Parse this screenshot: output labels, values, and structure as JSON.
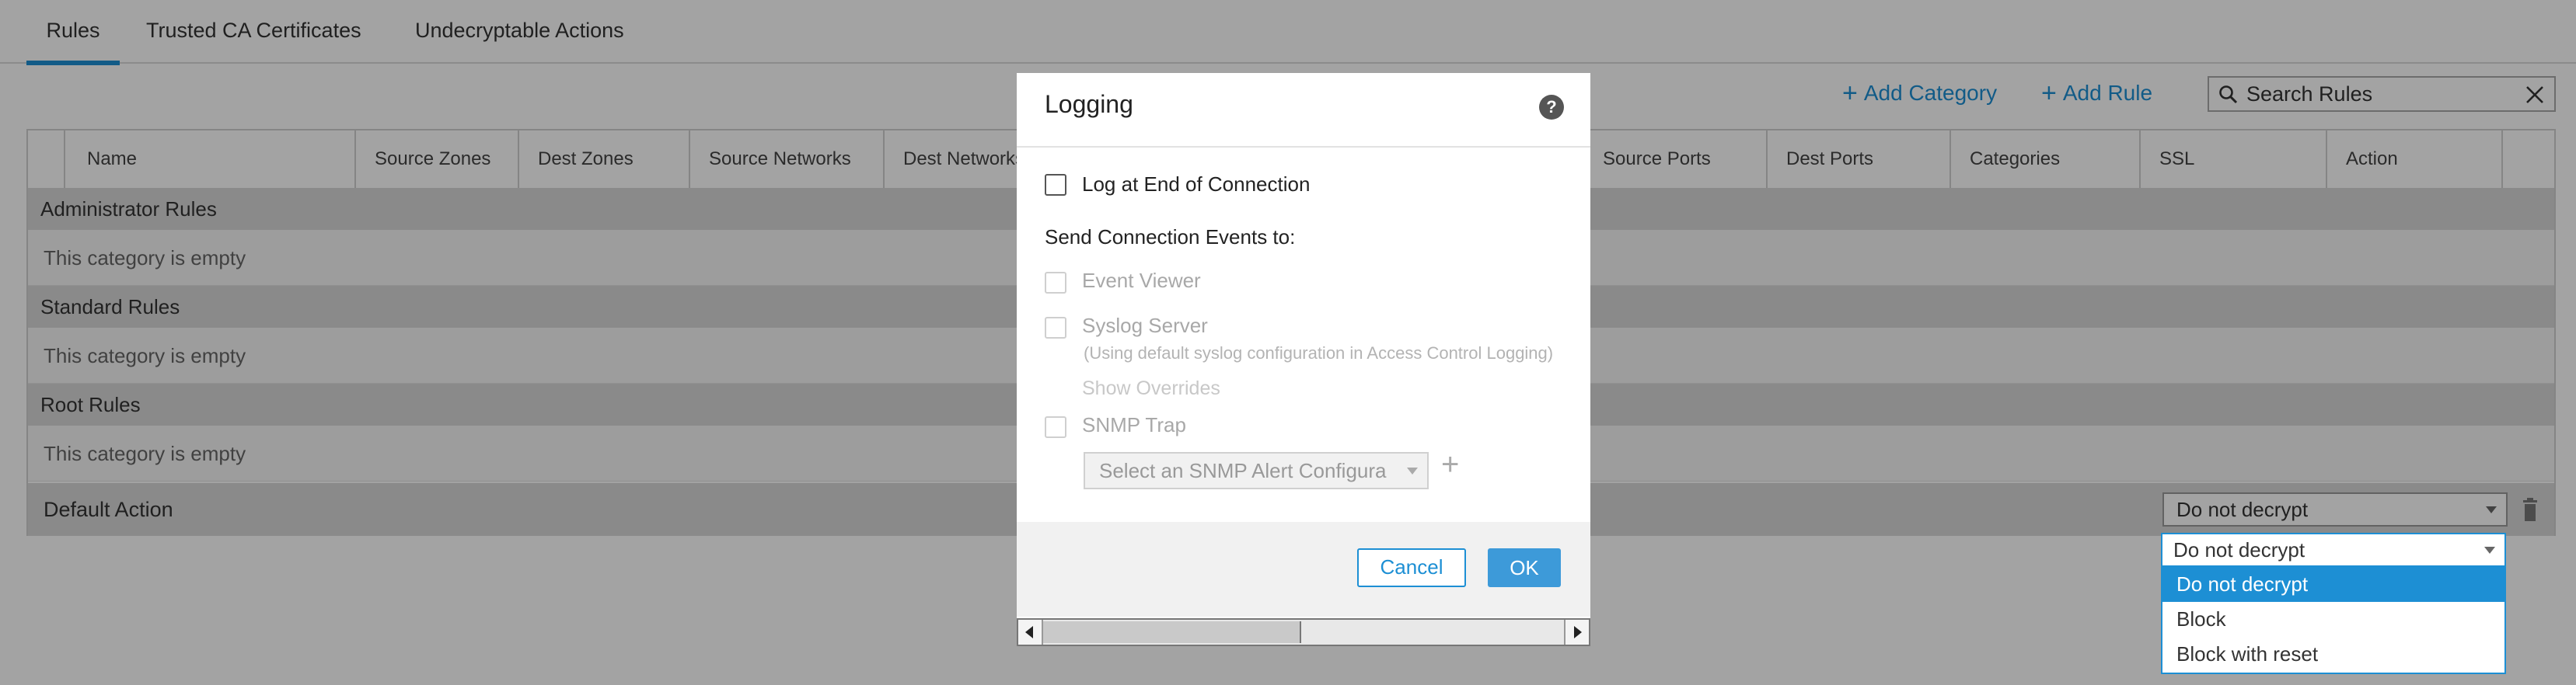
{
  "tabs": [
    {
      "label": "Rules"
    },
    {
      "label": "Trusted CA Certificates"
    },
    {
      "label": "Undecryptable Actions"
    }
  ],
  "toolbar": {
    "add_category": "Add Category",
    "add_rule": "Add Rule",
    "search_value": "Search Rules"
  },
  "table": {
    "columns": [
      "Name",
      "Source Zones",
      "Dest Zones",
      "Source Networks",
      "Dest Networks",
      "Source Ports",
      "Dest Ports",
      "Categories",
      "SSL",
      "Action"
    ],
    "categories": [
      {
        "name": "Administrator Rules",
        "empty_text": "This category is empty"
      },
      {
        "name": "Standard Rules",
        "empty_text": "This category is empty"
      },
      {
        "name": "Root Rules",
        "empty_text": "This category is empty"
      }
    ],
    "default_action": {
      "label": "Default Action",
      "selected": "Do not decrypt"
    }
  },
  "dropdown": {
    "current": "Do not decrypt",
    "options": [
      "Do not decrypt",
      "Block",
      "Block with reset"
    ],
    "selected_option": "Do not decrypt"
  },
  "modal": {
    "title": "Logging",
    "help": "?",
    "log_end_label": "Log at End of Connection",
    "send_events_label": "Send Connection Events to:",
    "event_viewer_label": "Event Viewer",
    "syslog_label": "Syslog Server",
    "syslog_note": "(Using default syslog configuration in Access Control Logging)",
    "show_overrides": "Show Overrides",
    "snmp_label": "SNMP Trap",
    "snmp_placeholder": "Select an SNMP Alert Configura",
    "add_snmp": "+",
    "cancel_label": "Cancel",
    "ok_label": "OK"
  },
  "colors": {
    "accent": "#1d8fd4",
    "category_row": "#d8d8d8",
    "overlay": "rgba(0,0,0,0.36)"
  },
  "icons": [
    "plus-icon",
    "search-icon",
    "close-icon",
    "chevron-down-icon",
    "trash-icon",
    "help-icon",
    "scroll-left-icon",
    "scroll-right-icon"
  ]
}
